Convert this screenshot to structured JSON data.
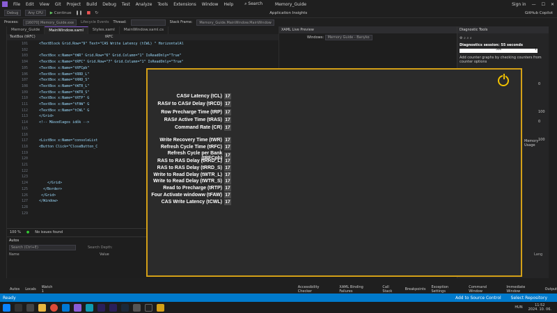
{
  "menubar": {
    "items": [
      "File",
      "Edit",
      "View",
      "Git",
      "Project",
      "Build",
      "Debug",
      "Test",
      "Analyze",
      "Tools",
      "Extensions",
      "Window",
      "Help"
    ],
    "search": "Search",
    "solution": "Memory_Guide",
    "signin": "Sign in",
    "copilot": "GitHub Copilot"
  },
  "toolbar": {
    "config": "Debug",
    "platform": "Any CPU",
    "continue": "Continue",
    "insights": "Application Insights"
  },
  "toolbar2": {
    "process": "Process:",
    "process_value": "[16070] Memory_Guide.exe",
    "lifecycle": "Lifecycle Events",
    "thread": "Thread:",
    "stackframe": "Stack Frame:",
    "stackvalue": "Memory_Guide.MainWindow.MainWindow"
  },
  "tabs": [
    "Memory_Guide",
    "MainWindow.xaml",
    "Styles.xaml",
    "MainWindow.xaml.cs"
  ],
  "editorhdr": {
    "left": "TextBox (tRFC)",
    "right": "tRFC"
  },
  "editor": {
    "lines": [
      {
        "n": "101",
        "t": "<TextBlock Grid.Row=\"9\" Text=\"CAS Write Latency (tCWL) \" HorizontalAl"
      },
      {
        "n": "102",
        "t": ""
      },
      {
        "n": "103",
        "t": "<TextBox x:Name=\"tWR\" Grid.Row=\"6\" Grid.Column=\"1\" IsReadOnly=\"True\""
      },
      {
        "n": "104",
        "t": "<TextBox x:Name=\"tRFC\" Grid.Row=\"7\" Grid.Column=\"1\" IsReadOnly=\"True\""
      },
      {
        "n": "105",
        "t": "<TextBox x:Name=\"tRFCpb\""
      },
      {
        "n": "106",
        "t": "<TextBox x:Name=\"tRRD_L\""
      },
      {
        "n": "107",
        "t": "<TextBox x:Name=\"tRRD_S\""
      },
      {
        "n": "108",
        "t": "<TextBox x:Name=\"tWTR_L\""
      },
      {
        "n": "109",
        "t": "<TextBox x:Name=\"tWTR_S\""
      },
      {
        "n": "110",
        "t": "<TextBox x:Name=\"tRTP\" G"
      },
      {
        "n": "111",
        "t": "<TextBox x:Name=\"tFAW\" G"
      },
      {
        "n": "112",
        "t": "<TextBox x:Name=\"tCWL\" G"
      },
      {
        "n": "113",
        "t": "</Grid>"
      },
      {
        "n": "114",
        "t": "<!-- Másodlagos idők -->"
      },
      {
        "n": "115",
        "t": ""
      },
      {
        "n": "116",
        "t": ""
      },
      {
        "n": "117",
        "t": "<ListBox x:Name=\"consoleList"
      },
      {
        "n": "118",
        "t": "<Button Click=\"CloseButton_C"
      },
      {
        "n": "119",
        "t": ""
      },
      {
        "n": "120",
        "t": ""
      },
      {
        "n": "121",
        "t": ""
      },
      {
        "n": "122",
        "t": ""
      },
      {
        "n": "123",
        "t": ""
      },
      {
        "n": "124",
        "t": "    </Grid>"
      },
      {
        "n": "125",
        "t": "  </Border>"
      },
      {
        "n": "126",
        "t": " </Grid>"
      },
      {
        "n": "127",
        "t": "</Window>"
      },
      {
        "n": "128",
        "t": ""
      },
      {
        "n": "129",
        "t": ""
      }
    ]
  },
  "statusleft": {
    "zoom": "100 %",
    "issues": "No issues found"
  },
  "autos": {
    "title": "Autos",
    "search": "Search (Ctrl+E)",
    "depth": "Search Depth:",
    "col_name": "Name",
    "col_value": "Value",
    "col_lang": "Lang"
  },
  "xaml": {
    "title": "XAML Live Preview",
    "window": "Windows:",
    "window_value": "Memory Guide - Banyko"
  },
  "diag": {
    "title": "Diagnostic Tools",
    "session": "Diagnostics session: 55 seconds",
    "tick1": "50s",
    "tick2": "1",
    "hint": "Add counter graphs by checking counters from counter options",
    "v1": "0",
    "v2": "100",
    "v3": "0",
    "v4": "100",
    "mem": "Memory Usage"
  },
  "bottomtabs": [
    "Autos",
    "Locals",
    "Watch 1",
    "Accessibility Checker",
    "XAML Binding Failures",
    "Call Stack",
    "Breakpoints",
    "Exception Settings",
    "Command Window",
    "Immediate Window",
    "Output"
  ],
  "statusbar": {
    "ready": "Ready",
    "source": "Add to Source Control",
    "repo": "Select Repository"
  },
  "taskbar": {
    "time": "11:52",
    "date": "2024. 10. 06.",
    "lang": "HUN"
  },
  "dialog": {
    "primary": [
      {
        "label": "CAS# Latency (tCL)",
        "value": "17"
      },
      {
        "label": "RAS# to CAS# Delay (tRCD)",
        "value": "17"
      },
      {
        "label": "Row Precharge Time (tRP)",
        "value": "17"
      },
      {
        "label": "RAS# Active Time (tRAS)",
        "value": "17"
      },
      {
        "label": "Command Rate (CR)",
        "value": "17"
      }
    ],
    "secondary": [
      {
        "label": "Write Recovery Time (tWR)",
        "value": "17"
      },
      {
        "label": "Refresh Cycle Time (tRFC)",
        "value": "17"
      },
      {
        "label": "Refresh Cycle per Bank (tRFCpb)",
        "value": "17"
      },
      {
        "label": "RAS to RAS Delay (tRRD_L)",
        "value": "17"
      },
      {
        "label": "RAS to RAS Delay (tRRD_S)",
        "value": "17"
      },
      {
        "label": "Write to Read Delay (tWTR_L)",
        "value": "17"
      },
      {
        "label": "Write to Read Delay (tWTR_S)",
        "value": "17"
      },
      {
        "label": "Read to Precharge (tRTP)",
        "value": "17"
      },
      {
        "label": "Four Activate windoww (tFAW)",
        "value": "17"
      },
      {
        "label": "CAS Write Latency (tCWL)",
        "value": "17"
      }
    ],
    "accent": "#d4a017"
  }
}
